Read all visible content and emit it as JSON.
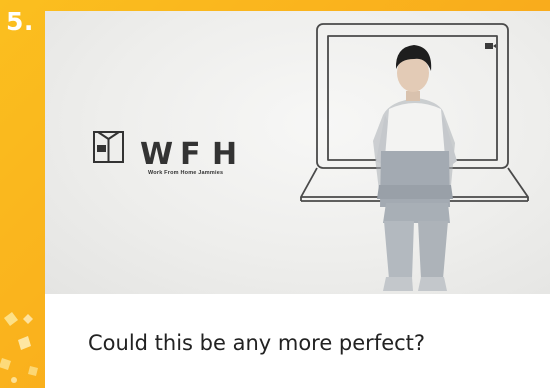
{
  "list_item": {
    "number": "5.",
    "caption": "Could this be any more perfect?"
  },
  "product_logo": {
    "letters": [
      "W",
      "F",
      "H"
    ],
    "tagline": "Work From Home Jammies"
  },
  "colors": {
    "background": "#f9ad1c",
    "number_text": "#ffffff",
    "caption_text": "#222222",
    "logo_ink": "#333333"
  }
}
